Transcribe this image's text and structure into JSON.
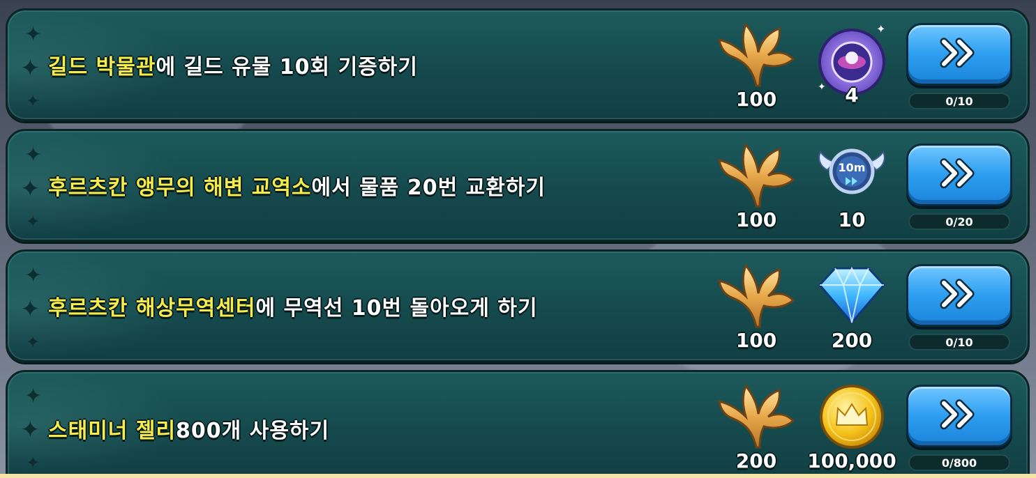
{
  "missions": [
    {
      "title_highlight": "길드 박물관",
      "title_rest": "에 길드 유물 10회 기증하기",
      "reward_primary": {
        "icon": "golden-leaf-icon",
        "amount": "100"
      },
      "reward_secondary": {
        "icon": "treasure-box-icon",
        "amount": "4"
      },
      "progress": "0/10"
    },
    {
      "title_highlight": "후르츠칸 앵무의 해변 교역소",
      "title_rest": "에서 물품 20번 교환하기",
      "reward_primary": {
        "icon": "golden-leaf-icon",
        "amount": "100"
      },
      "reward_secondary": {
        "icon": "speedup-10m-icon",
        "amount": "10",
        "badge_text": "10m"
      },
      "progress": "0/20"
    },
    {
      "title_highlight": "후르츠칸 해상무역센터",
      "title_rest": "에 무역선 10번 돌아오게 하기",
      "reward_primary": {
        "icon": "golden-leaf-icon",
        "amount": "100"
      },
      "reward_secondary": {
        "icon": "crystal-gem-icon",
        "amount": "200"
      },
      "progress": "0/10"
    },
    {
      "title_highlight": "스태미너 젤리",
      "title_rest": " 800개 사용하기",
      "reward_primary": {
        "icon": "golden-leaf-icon",
        "amount": "200"
      },
      "reward_secondary": {
        "icon": "gold-coin-icon",
        "amount": "100,000"
      },
      "progress": "0/800"
    }
  ],
  "colors": {
    "highlight_text": "#f7ec4a",
    "row_background": "#154a4d",
    "go_button": "#2d9ef0"
  }
}
